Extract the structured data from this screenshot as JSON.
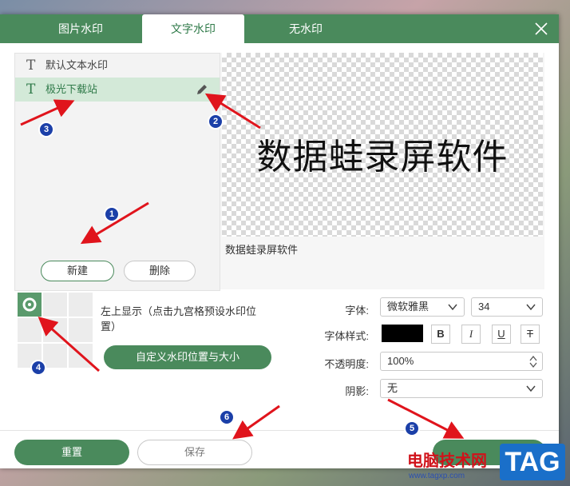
{
  "tabs": [
    {
      "label": "图片水印"
    },
    {
      "label": "文字水印"
    },
    {
      "label": "无水印"
    }
  ],
  "watermark_list": [
    {
      "label": "默认文本水印",
      "icon": "T"
    },
    {
      "label": "极光下载站",
      "icon": "T"
    }
  ],
  "list_buttons": {
    "new": "新建",
    "delete": "删除"
  },
  "preview": {
    "text": "数据蛙录屏软件",
    "caption": "数据蛙录屏软件"
  },
  "position": {
    "text": "左上显示（点击九宫格预设水印位置）",
    "custom_button": "自定义水印位置与大小"
  },
  "font": {
    "font_label": "字体:",
    "font_value": "微软雅黑",
    "size_value": "34",
    "style_label": "字体样式:",
    "color": "#000000",
    "bold": "B",
    "italic": "I",
    "underline": "U",
    "strike": "T",
    "opacity_label": "不透明度:",
    "opacity_value": "100%",
    "shadow_label": "阴影:",
    "shadow_value": "无"
  },
  "footer": {
    "reset": "重置",
    "save": "保存"
  },
  "badges": [
    "1",
    "2",
    "3",
    "4",
    "5",
    "6"
  ],
  "site_watermark": {
    "title": "电脑技术网",
    "url": "www.tagxp.com",
    "tag": "TAG"
  },
  "colors": {
    "brand": "#4a8a5c",
    "annotation_arrow": "#e0141c",
    "badge": "#1b3fa8"
  }
}
